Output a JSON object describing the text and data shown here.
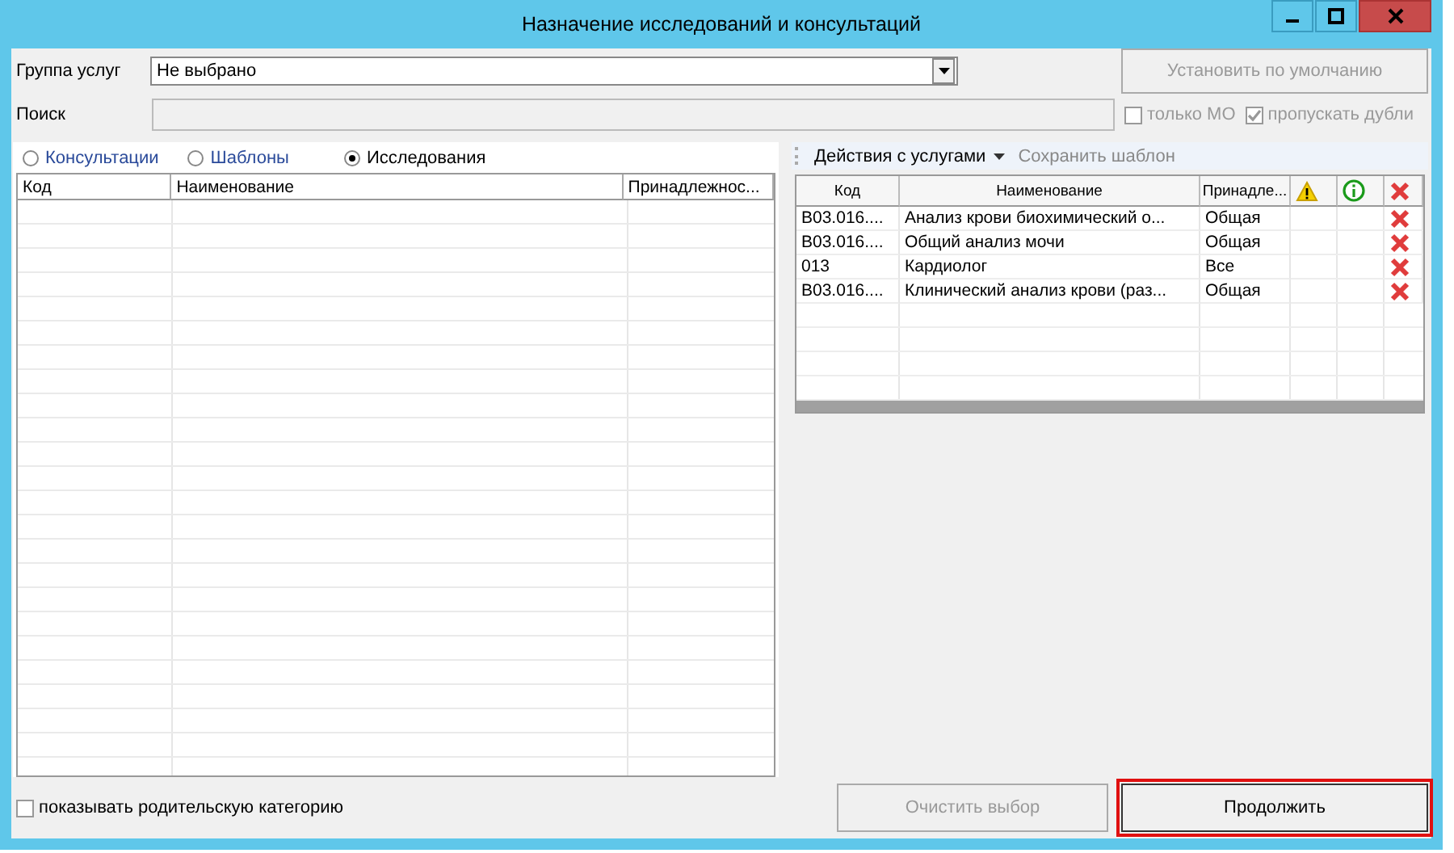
{
  "window": {
    "title": "Назначение исследований и консультаций"
  },
  "group": {
    "label": "Группа услуг",
    "value": "Не выбрано"
  },
  "default_button": {
    "label": "Установить по умолчанию",
    "disabled": true
  },
  "search": {
    "label": "Поиск",
    "disabled": true
  },
  "filters": [
    {
      "label": "только МО",
      "checked": false,
      "disabled": true
    },
    {
      "label": "пропускать дубли",
      "checked": true,
      "disabled": true
    }
  ],
  "tabs": [
    {
      "label": "Консультации",
      "selected": false
    },
    {
      "label": "Шаблоны",
      "selected": false
    },
    {
      "label": "Исследования",
      "selected": true
    }
  ],
  "left_table": {
    "columns": [
      "Код",
      "Наименование",
      "Принадлежнос..."
    ]
  },
  "toolbar": [
    {
      "label": "Действия с услугами",
      "kind": "menu",
      "disabled": false
    },
    {
      "label": "Сохранить шаблон",
      "kind": "button",
      "disabled": true
    }
  ],
  "right_table": {
    "columns": [
      {
        "kind": "text",
        "label": "Код"
      },
      {
        "kind": "text",
        "label": "Наименование"
      },
      {
        "kind": "text",
        "label": "Принадле..."
      },
      {
        "kind": "warning"
      },
      {
        "kind": "info"
      },
      {
        "kind": "delete"
      }
    ],
    "rows": [
      {
        "code": "B03.016....",
        "name": "Анализ крови биохимический о...",
        "owner": "Общая"
      },
      {
        "code": "B03.016....",
        "name": "Общий анализ мочи",
        "owner": "Общая"
      },
      {
        "code": "013",
        "name": "Кардиолог",
        "owner": "Все"
      },
      {
        "code": "B03.016....",
        "name": "Клинический анализ крови (раз...",
        "owner": "Общая"
      }
    ]
  },
  "parent_category": {
    "label": "показывать родительскую категорию",
    "checked": false
  },
  "buttons": [
    {
      "label": "Очистить выбор",
      "disabled": true,
      "highlighted": false
    },
    {
      "label": "Продолжить",
      "disabled": false,
      "highlighted": true
    }
  ]
}
